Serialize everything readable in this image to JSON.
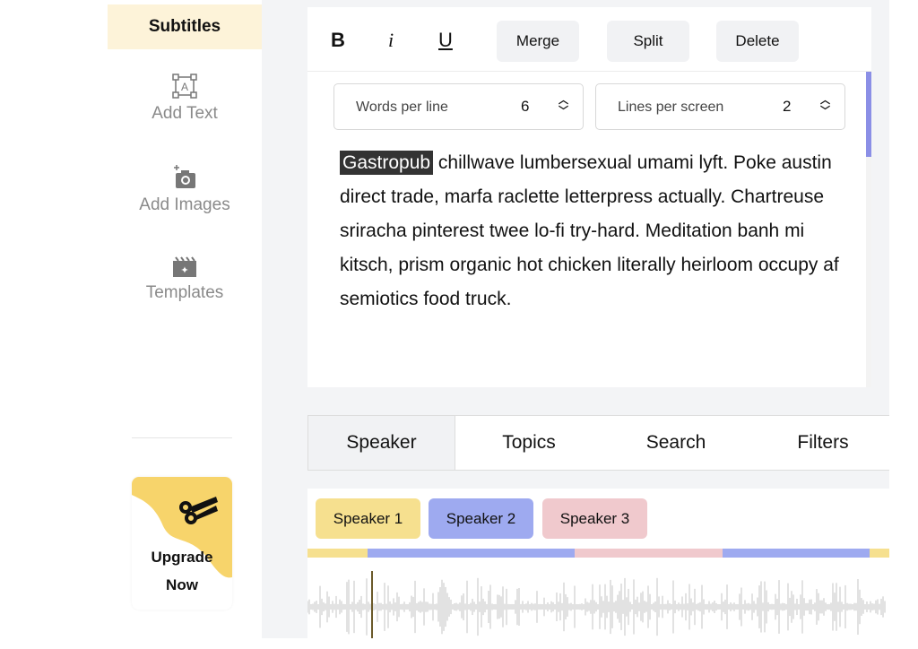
{
  "sidebar": {
    "active": "Subtitles",
    "items": [
      {
        "label": "Add Text",
        "icon": "text-box-icon"
      },
      {
        "label": "Add Images",
        "icon": "add-photo-icon"
      },
      {
        "label": "Templates",
        "icon": "templates-icon"
      }
    ],
    "upgrade": {
      "line1": "Upgrade",
      "line2": "Now",
      "icon": "scissors-clapper-icon",
      "color": "#f7d46b"
    }
  },
  "toolbar": {
    "bold": "B",
    "italic": "i",
    "underline": "U",
    "merge": "Merge",
    "split": "Split",
    "delete": "Delete"
  },
  "settings": {
    "words_label": "Words per line",
    "words_value": "6",
    "lines_label": "Lines per screen",
    "lines_value": "2"
  },
  "editor": {
    "highlighted": "Gastropub",
    "text": " chillwave lumbersexual umami lyft. Poke austin direct trade, marfa raclette letterpress actually. Chartreuse sriracha pinterest twee lo-fi try-hard. Meditation banh mi kitsch, prism organic hot chicken literally heirloom occupy af semiotics food truck."
  },
  "tabs": [
    {
      "label": "Speaker",
      "active": true
    },
    {
      "label": "Topics"
    },
    {
      "label": "Search"
    },
    {
      "label": "Filters"
    }
  ],
  "speakers": [
    {
      "label": "Speaker 1",
      "color": "#f6e08f"
    },
    {
      "label": "Speaker 2",
      "color": "#9eaaf0"
    },
    {
      "label": "Speaker 3",
      "color": "#f0c9cd"
    }
  ],
  "timeline": [
    "Speaker 1",
    "Speaker 2",
    "Speaker 3",
    "Speaker 2",
    "Speaker 1"
  ]
}
